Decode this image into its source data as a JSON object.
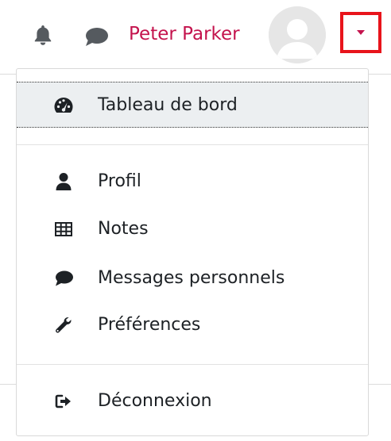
{
  "navbar": {
    "user_name": "Peter Parker",
    "accent_color": "#c4134d",
    "highlight_color": "#e8141b",
    "icons": [
      "bell-icon",
      "chat-bubble-icon",
      "avatar-icon",
      "caret-down-icon"
    ]
  },
  "dropdown": {
    "items": [
      {
        "label": "Tableau de bord",
        "icon": "dashboard-gauge-icon",
        "active": true
      },
      {
        "label": "Profil",
        "icon": "user-icon"
      },
      {
        "label": "Notes",
        "icon": "grades-table-icon"
      },
      {
        "label": "Messages personnels",
        "icon": "message-bubble-icon"
      },
      {
        "label": "Préférences",
        "icon": "wrench-icon"
      },
      {
        "label": "Déconnexion",
        "icon": "sign-out-icon"
      }
    ]
  }
}
